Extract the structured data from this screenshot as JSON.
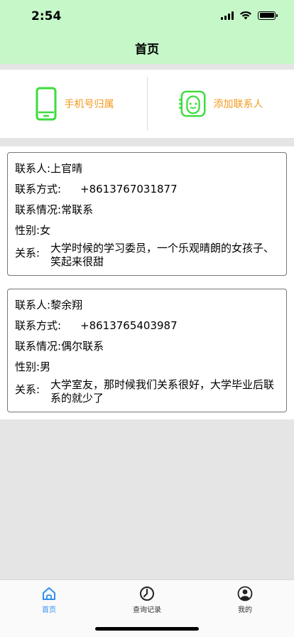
{
  "status_bar": {
    "time": "2:54"
  },
  "nav": {
    "title": "首页"
  },
  "tools": [
    {
      "label": "手机号归属",
      "icon": "phone-device-icon"
    },
    {
      "label": "添加联系人",
      "icon": "add-contact-face-icon"
    }
  ],
  "contacts": [
    {
      "name_label": "联系人:",
      "name": "上官晴",
      "phone_label": "联系方式:",
      "phone": "+8613767031877",
      "status_label": "联系情况:",
      "status": "常联系",
      "gender_label": "性别:",
      "gender": "女",
      "relation_label": "关系:",
      "relation": "大学时候的学习委员，一个乐观晴朗的女孩子、笑起来很甜"
    },
    {
      "name_label": "联系人:",
      "name": "黎余翔",
      "phone_label": "联系方式:",
      "phone": "+8613765403987",
      "status_label": "联系情况:",
      "status": "偶尔联系",
      "gender_label": "性别:",
      "gender": "男",
      "relation_label": "关系:",
      "relation": "大学室友，那时候我们关系很好，大学毕业后联系的就少了"
    }
  ],
  "tabbar": [
    {
      "label": "首页",
      "icon": "home-icon",
      "active": true
    },
    {
      "label": "查询记录",
      "icon": "clock-icon",
      "active": false
    },
    {
      "label": "我的",
      "icon": "user-icon",
      "active": false
    }
  ],
  "colors": {
    "header_bg": "#c6f7c9",
    "accent_green": "#3ddc3d",
    "label_orange": "#f39a1e",
    "tab_active": "#2f8ef0"
  }
}
